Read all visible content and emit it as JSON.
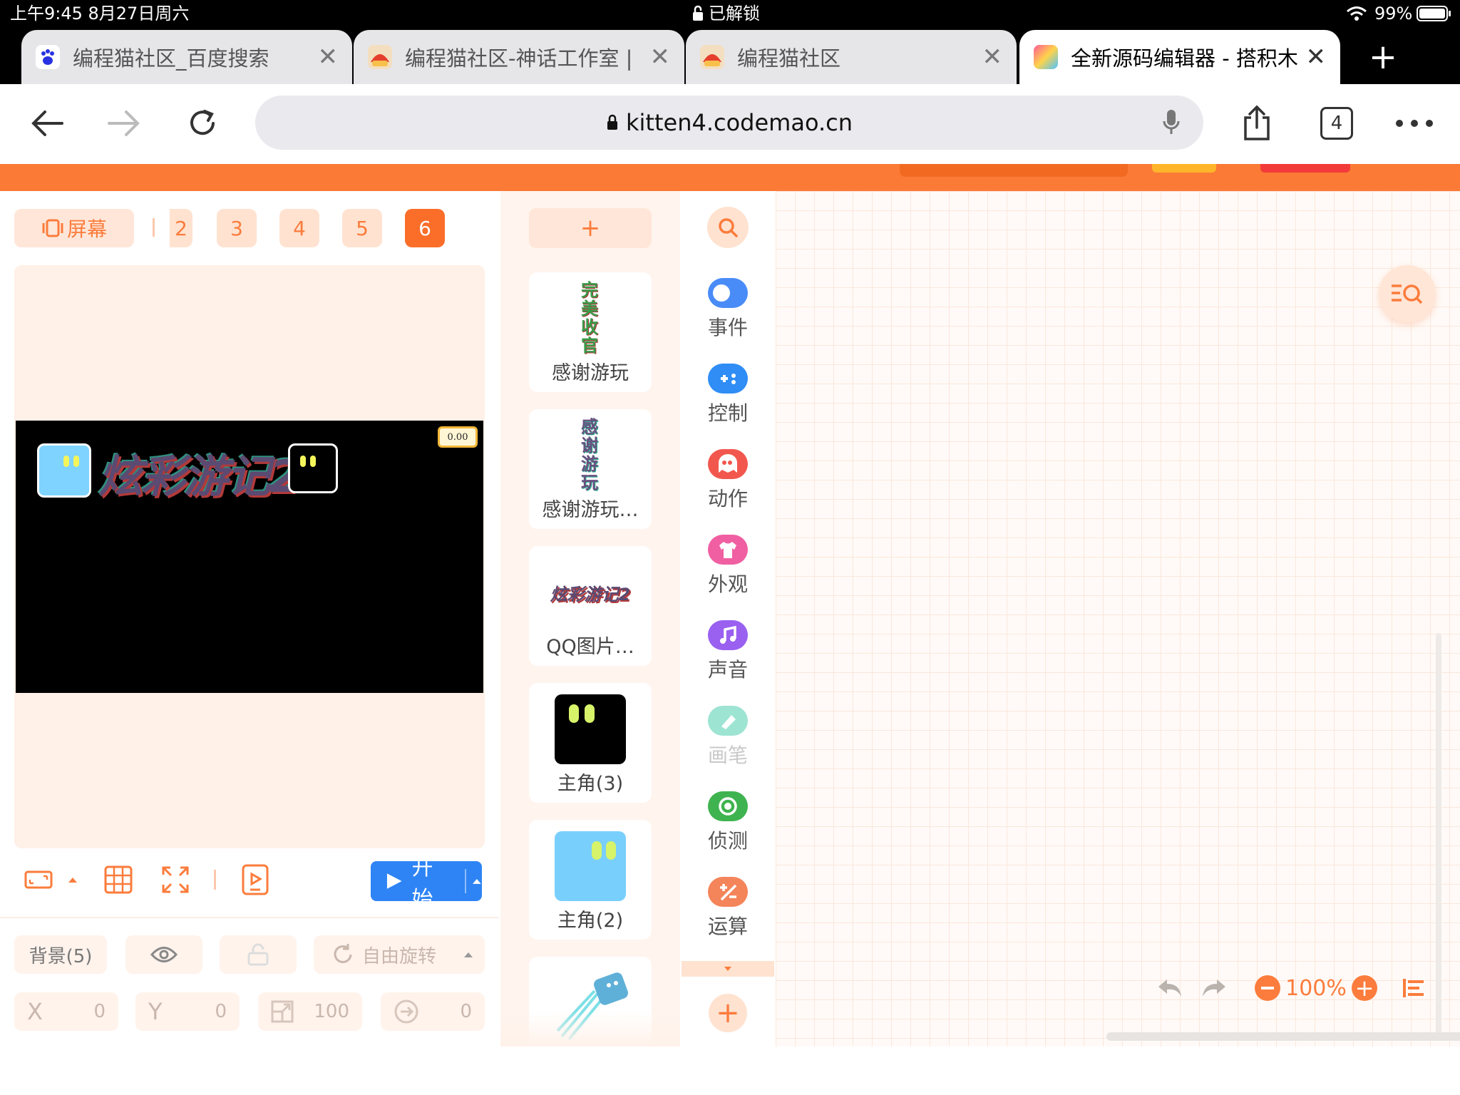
{
  "status_bar": {
    "time_date": "上午9:45   8月27日周六",
    "lock_text": "已解锁",
    "battery": "99%"
  },
  "tabs": [
    {
      "title": "编程猫社区_百度搜索",
      "active": false
    },
    {
      "title": "编程猫社区-神话工作室 |",
      "active": false
    },
    {
      "title": "编程猫社区",
      "active": false
    },
    {
      "title": "全新源码编辑器 - 搭积木-",
      "active": true
    }
  ],
  "address_bar": {
    "url": "kitten4.codemao.cn",
    "tab_count": "4"
  },
  "stage_panel": {
    "screen_label": "屏幕",
    "scenes": [
      "2",
      "3",
      "4",
      "5",
      "6"
    ],
    "selected_scene": "6",
    "stage_title_art": "炫彩游记2",
    "stage_badge": "0.00",
    "start_button": "开始",
    "background_label": "背景(5)",
    "rotation_label": "自由旋转",
    "props": [
      {
        "key": "X",
        "value": "0"
      },
      {
        "key": "Y",
        "value": "0"
      },
      {
        "key": "size",
        "value": "100"
      },
      {
        "key": "direction",
        "value": "0"
      }
    ]
  },
  "sprites": [
    {
      "name": "感谢游玩",
      "art_text": "完美收官"
    },
    {
      "name": "感谢游玩…",
      "art_text": "感谢游玩"
    },
    {
      "name": "QQ图片…",
      "art_text": "炫彩游记2"
    },
    {
      "name": "主角(3)"
    },
    {
      "name": "主角(2)"
    }
  ],
  "add_sprite_label": "+",
  "categories": [
    {
      "label": "事件",
      "color": "#4a8cf7"
    },
    {
      "label": "控制",
      "color": "#2f8df5"
    },
    {
      "label": "动作",
      "color": "#f2574e"
    },
    {
      "label": "外观",
      "color": "#f05fa2"
    },
    {
      "label": "声音",
      "color": "#9a60f0"
    },
    {
      "label": "画笔",
      "color": "#9de4d3"
    },
    {
      "label": "侦测",
      "color": "#3fb34f"
    },
    {
      "label": "运算",
      "color": "#f4845a"
    }
  ],
  "workspace": {
    "zoom": "100%"
  }
}
